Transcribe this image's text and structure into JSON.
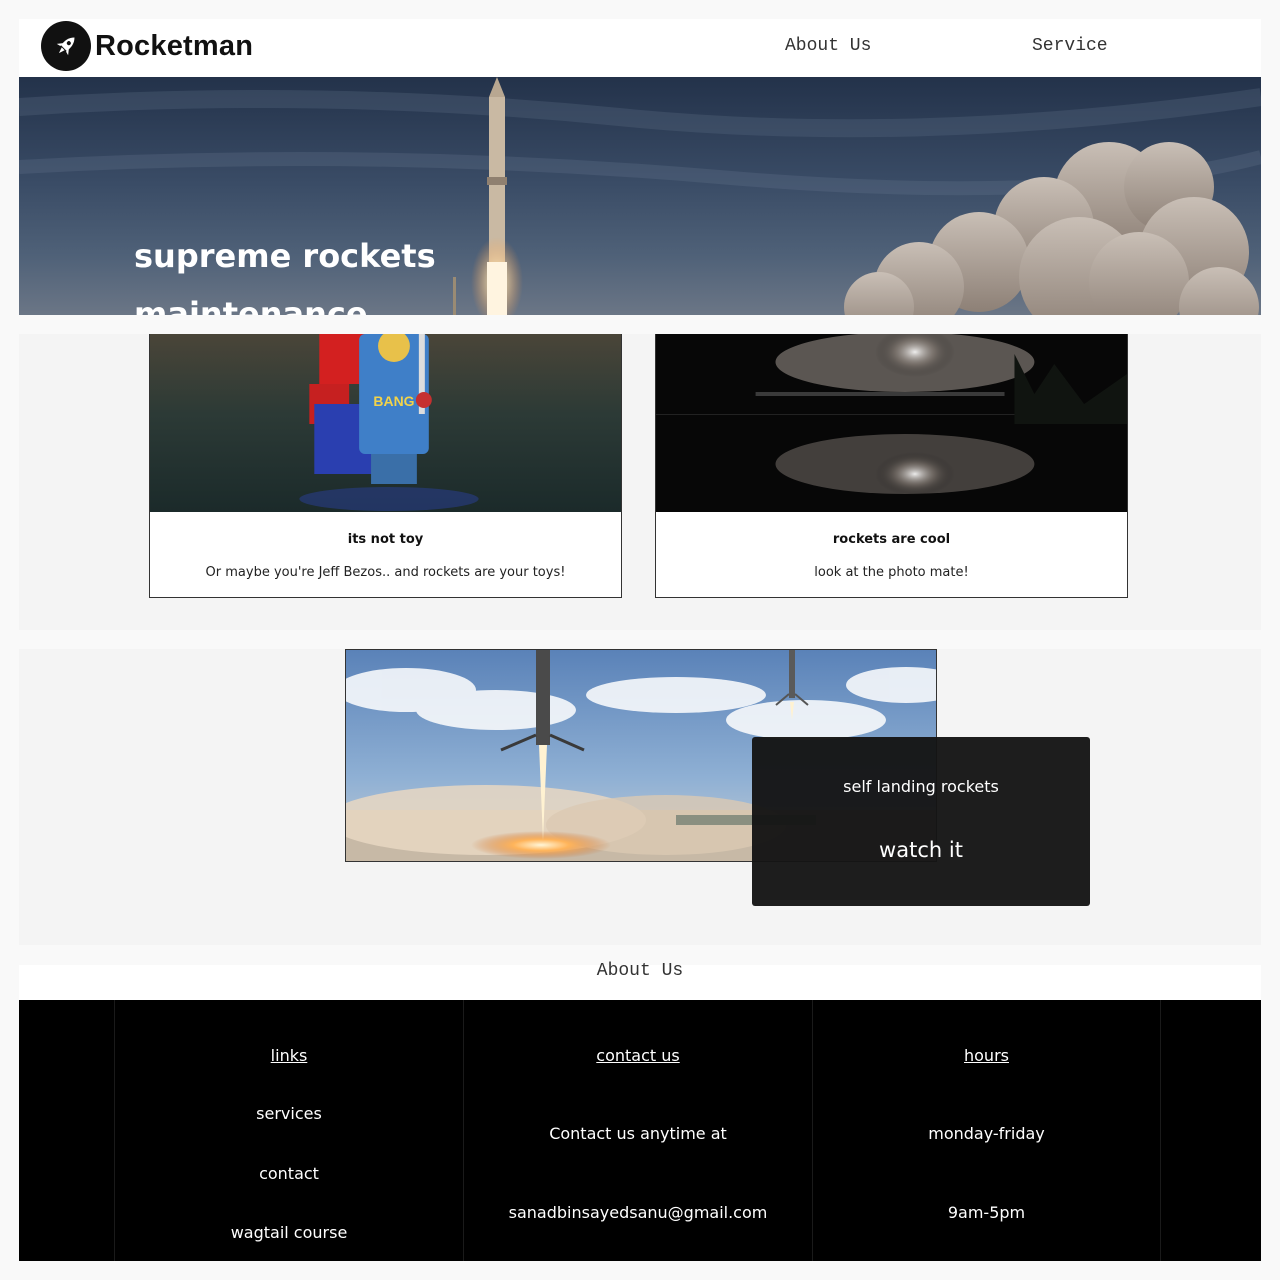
{
  "header": {
    "brand": "Rocketman",
    "nav": [
      "About Us",
      "Service"
    ]
  },
  "hero": {
    "title_line1": "supreme rockets",
    "title_line2": "maintenance"
  },
  "cards": [
    {
      "title": "its not toy",
      "text": "Or maybe you're Jeff Bezos.. and rockets are your toys!"
    },
    {
      "title": "rockets are cool",
      "text": "look at the photo mate!"
    }
  ],
  "feature": {
    "title": "self landing rockets",
    "cta": "watch it"
  },
  "about_label": "About Us",
  "footer": {
    "links": {
      "heading": "links",
      "items": [
        "services",
        "contact",
        "wagtail course"
      ]
    },
    "contact": {
      "heading": "contact us",
      "line1": "Contact us anytime at",
      "email": "sanadbinsayedsanu@gmail.com"
    },
    "hours": {
      "heading": "hours",
      "days": "monday-friday",
      "time": "9am-5pm"
    }
  },
  "icons": {
    "brand_logo": "rocket-icon"
  },
  "colors": {
    "navbar_bg": "#ffffff",
    "footer_bg": "#000000",
    "section_bg": "#f4f4f4",
    "overlay_bg": "#141414"
  }
}
